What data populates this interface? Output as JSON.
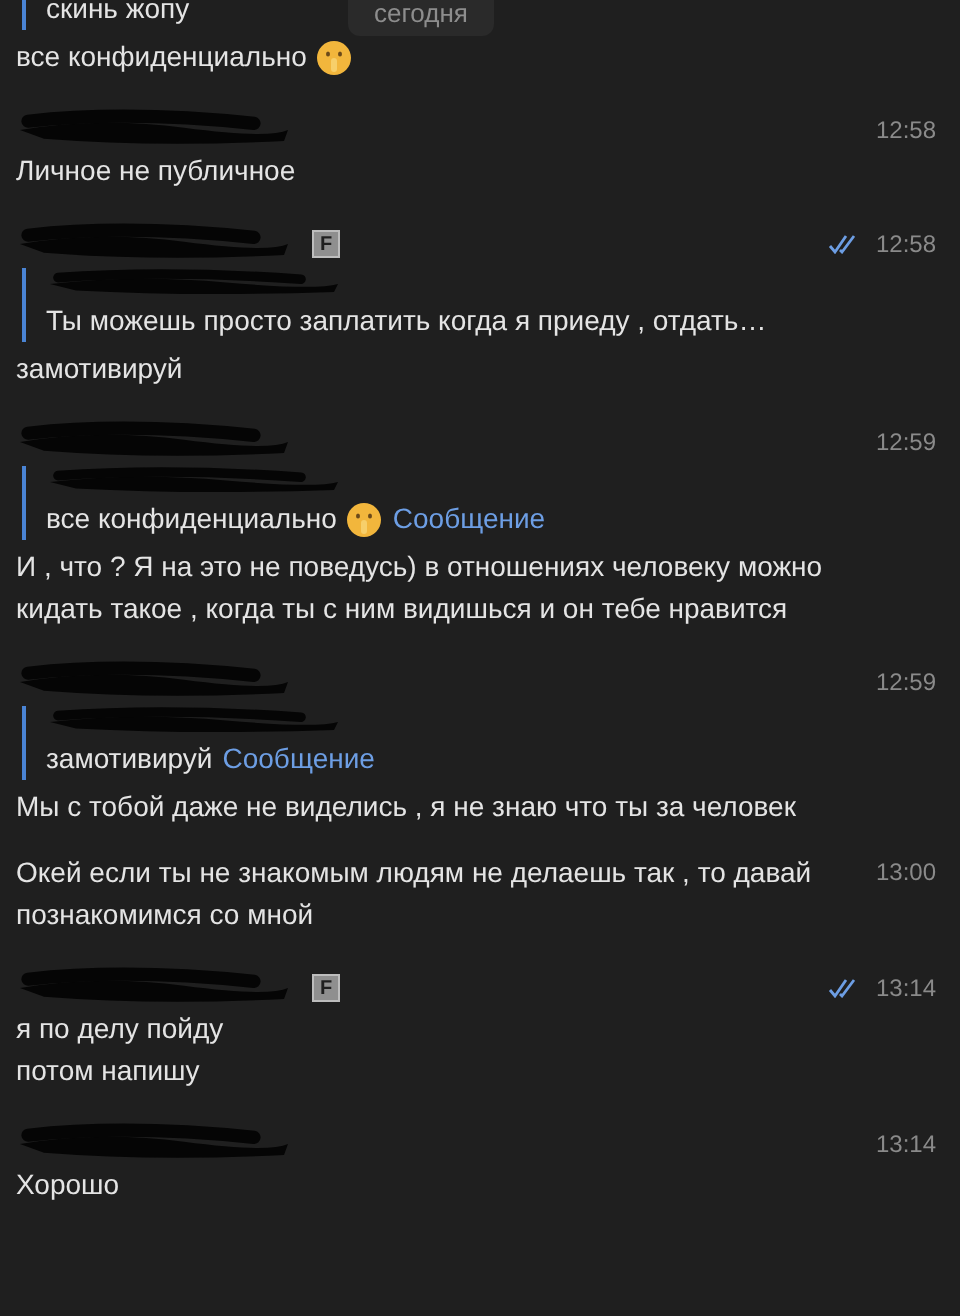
{
  "date_pill": "сегодня",
  "messages": [
    {
      "kind": "continuation",
      "reply": {
        "text": "скинь жопу"
      },
      "lines": [
        "все конфиденциально"
      ],
      "emoji": true
    },
    {
      "kind": "message",
      "time": "12:58",
      "lines": [
        "Личное не публичное"
      ]
    },
    {
      "kind": "message",
      "badge": "F",
      "read": true,
      "time": "12:58",
      "reply": {
        "text": "Ты можешь просто заплатить когда я приеду , отдать…",
        "sender_redacted": true
      },
      "lines": [
        "замотивируй"
      ]
    },
    {
      "kind": "message",
      "time": "12:59",
      "reply": {
        "text": "все конфиденциально",
        "link": "Сообщение",
        "emoji": true,
        "sender_redacted": true
      },
      "lines": [
        "И , что ? Я на это не поведусь) в отношениях человеку можно",
        "кидать такое , когда ты с ним видишься и он тебе нравится"
      ]
    },
    {
      "kind": "message",
      "time": "12:59",
      "reply": {
        "text": "замотивируй",
        "link": "Сообщение",
        "sender_redacted": true
      },
      "lines": [
        "Мы с тобой даже не виделись , я не знаю что ты за человек"
      ]
    },
    {
      "kind": "continuation",
      "time": "13:00",
      "lines": [
        "Окей если ты не знакомым людям не делаешь так , то давай",
        "познакомимся со мной"
      ]
    },
    {
      "kind": "message",
      "badge": "F",
      "read": true,
      "time": "13:14",
      "lines": [
        "я по делу пойду",
        "потом напишу"
      ]
    },
    {
      "kind": "message",
      "time": "13:14",
      "lines": [
        "Хорошо"
      ]
    }
  ]
}
